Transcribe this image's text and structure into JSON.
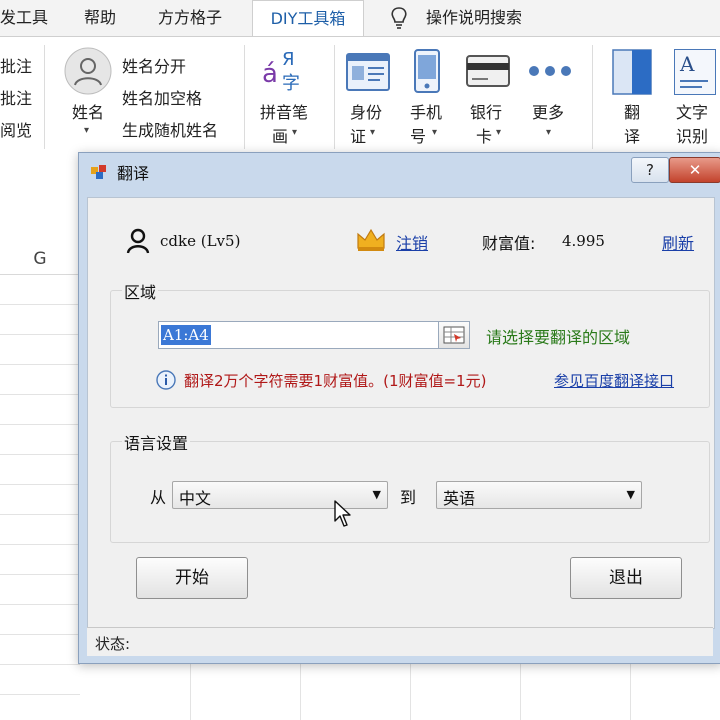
{
  "ribbon_tabs": [
    "发工具",
    "帮助",
    "方方格子",
    "DIY工具箱",
    "操作说明搜索"
  ],
  "ribbon": {
    "left_items": [
      "批注",
      "批注",
      "阅览"
    ],
    "name_button": "姓名",
    "name_menu": [
      "姓名分开",
      "姓名加空格",
      "生成随机姓名"
    ],
    "pinyin": [
      "拼音笔",
      "画"
    ],
    "pinyin_glyph": "Я",
    "pinyin_char": "字",
    "pinyin_accent": "á",
    "id_card": [
      "身份",
      "证"
    ],
    "phone": [
      "手机",
      "号"
    ],
    "bank": [
      "银行",
      "卡"
    ],
    "more": "更多",
    "translate": [
      "翻",
      "译"
    ],
    "ocr": [
      "文字",
      "识别"
    ],
    "ocr_glyph": "A"
  },
  "sheet": {
    "column_header": "G"
  },
  "dialog": {
    "title": "翻译",
    "help": "?",
    "close": "✕",
    "user": "cdke (Lv5)",
    "logout": "注销",
    "wealth_label": "财富值:",
    "wealth_value": "4.995",
    "refresh": "刷新",
    "region_title": "区域",
    "range_value": "A1:A4",
    "region_hint": "请选择要翻译的区域",
    "info_text": "翻译2万个字符需要1财富值。(1财富值=1元)",
    "baidu_link": "参见百度翻译接口",
    "lang_title": "语言设置",
    "from_label": "从",
    "from_value": "中文",
    "to_label": "到",
    "to_value": "英语",
    "start_button": "开始",
    "exit_button": "退出",
    "status_label": "状态:"
  },
  "colors": {
    "accent": "#1e5fa8",
    "link": "#1a3fa8",
    "hint_green": "#2a7a1a",
    "info_red": "#b01818",
    "selection": "#3b78d6"
  }
}
